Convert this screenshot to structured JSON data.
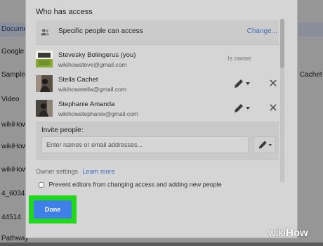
{
  "background_list": {
    "rows": [
      {
        "left": "Docume",
        "right": "",
        "selected": true
      },
      {
        "left": "Google Do",
        "right": "",
        "selected": false
      },
      {
        "left": "Sample",
        "right": "Cachet",
        "selected": false
      },
      {
        "left": "Video",
        "right": "",
        "selected": false
      },
      {
        "left": "wikiHow",
        "right": "",
        "selected": false
      },
      {
        "left": "wikiHow",
        "right": "",
        "selected": false
      },
      {
        "left": "wikiHow",
        "right": "",
        "selected": false
      },
      {
        "left": "4_6034",
        "right": "",
        "selected": false
      },
      {
        "left": "44514",
        "right": "",
        "selected": false
      },
      {
        "left": "Pathway",
        "right": "",
        "selected": false
      }
    ]
  },
  "dialog": {
    "title": "Who has access",
    "access": {
      "icon": "people-icon",
      "label": "Specific people can access",
      "change_link": "Change..."
    },
    "people": [
      {
        "name": "Stevesky Bolingerus (you)",
        "email": "wikihowsteve@gmail.com",
        "role": "Is owner",
        "avatar": "wikihow-logo-avatar"
      },
      {
        "name": "Stella Cachet",
        "email": "wikihowstella@gmail.com",
        "role": "",
        "avatar": "person-avatar"
      },
      {
        "name": "Stephanie Amanda",
        "email": "wikihowstephanie@gmail.com",
        "role": "",
        "avatar": "person-avatar"
      }
    ],
    "invite": {
      "label": "Invite people:",
      "placeholder": "Enter names or email addresses..."
    },
    "owner_settings": {
      "label": "Owner settings",
      "learn_more": "Learn more",
      "prevent_editors": "Prevent editors from changing access and adding new people",
      "prevent_checked": false
    },
    "done_label": "Done"
  },
  "watermark": {
    "wiki": "wiki",
    "how": "How"
  },
  "colors": {
    "highlight": "#22d81e",
    "primary_button": "#3f7fe8",
    "link": "#3f6cb8"
  }
}
